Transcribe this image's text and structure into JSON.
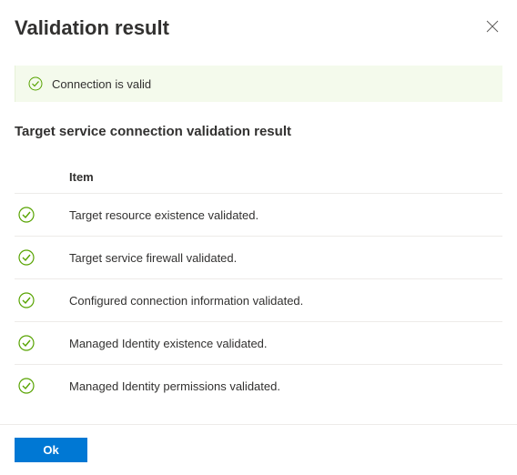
{
  "header": {
    "title": "Validation result"
  },
  "banner": {
    "message": "Connection is valid"
  },
  "section": {
    "title": "Target service connection validation result"
  },
  "table": {
    "header": {
      "item": "Item"
    },
    "rows": [
      {
        "status": "success",
        "item": "Target resource existence validated."
      },
      {
        "status": "success",
        "item": "Target service firewall validated."
      },
      {
        "status": "success",
        "item": "Configured connection information validated."
      },
      {
        "status": "success",
        "item": "Managed Identity existence validated."
      },
      {
        "status": "success",
        "item": "Managed Identity permissions validated."
      }
    ]
  },
  "footer": {
    "ok_label": "Ok"
  }
}
